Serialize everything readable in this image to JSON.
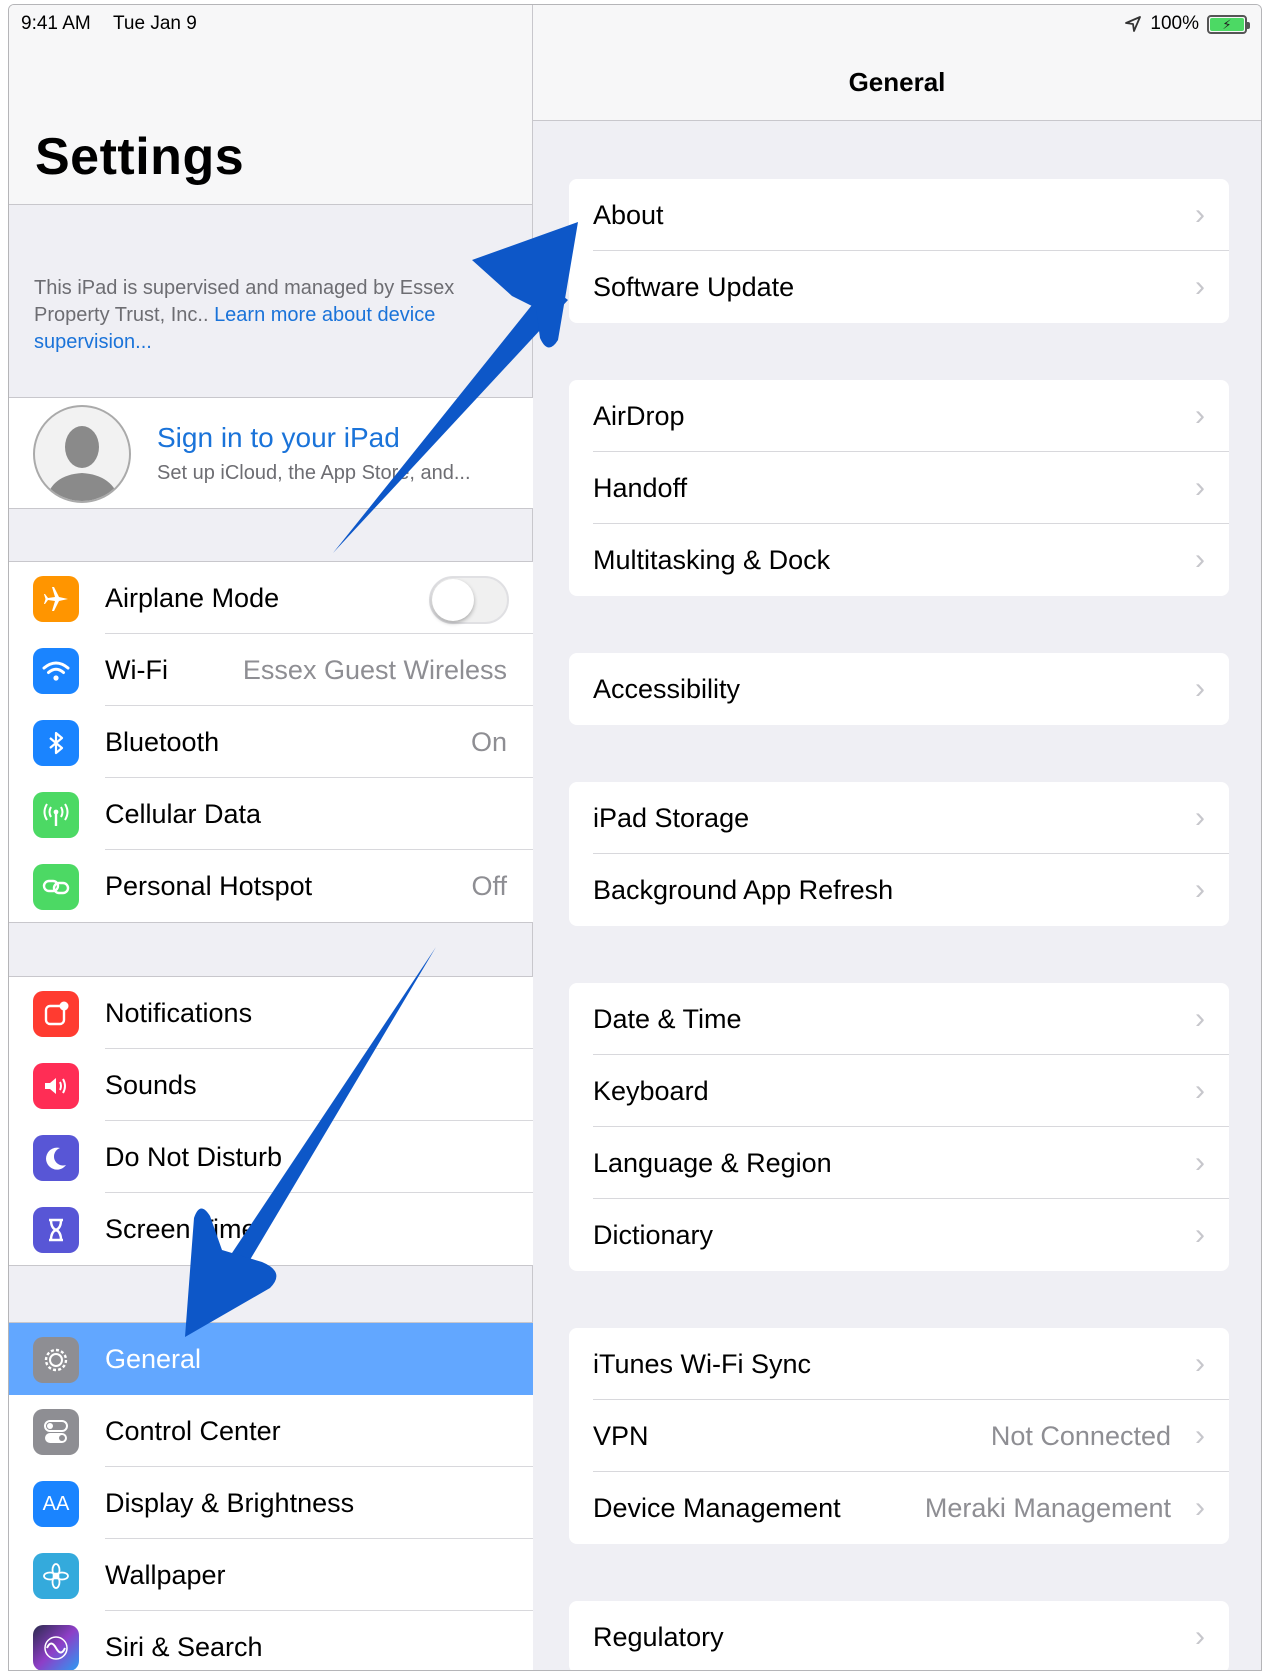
{
  "status_bar": {
    "time": "9:41 AM",
    "date": "Tue Jan 9",
    "battery": "100%"
  },
  "master": {
    "title": "Settings",
    "supervision_text": "This iPad is supervised and managed by Essex Property Trust, Inc.. ",
    "supervision_link": "Learn more about device supervision...",
    "profile": {
      "name": "Sign in to your iPad",
      "subtitle": "Set up iCloud, the App Store, and..."
    },
    "connectivity": [
      {
        "label": "Airplane Mode",
        "value": "",
        "icon": "airplane-icon",
        "color": "#ff9500"
      },
      {
        "label": "Wi-Fi",
        "value": "Essex Guest Wireless",
        "icon": "wifi-icon",
        "color": "#1a84ff"
      },
      {
        "label": "Bluetooth",
        "value": "On",
        "icon": "bluetooth-icon",
        "color": "#1a84ff"
      },
      {
        "label": "Cellular Data",
        "value": "",
        "icon": "antenna-icon",
        "color": "#4cd964"
      },
      {
        "label": "Personal Hotspot",
        "value": "Off",
        "icon": "hotspot-icon",
        "color": "#4cd964"
      }
    ],
    "notifications": [
      {
        "label": "Notifications",
        "icon": "notifications-icon",
        "color": "#ff3b30"
      },
      {
        "label": "Sounds",
        "icon": "speaker-icon",
        "color": "#ff2d55"
      },
      {
        "label": "Do Not Disturb",
        "icon": "moon-icon",
        "color": "#5856d6"
      },
      {
        "label": "Screen Time",
        "icon": "hourglass-icon",
        "color": "#5856d6"
      }
    ],
    "general": [
      {
        "label": "General",
        "icon": "gear-icon",
        "color": "#8e8e93"
      },
      {
        "label": "Control Center",
        "icon": "switches-icon",
        "color": "#8e8e93"
      },
      {
        "label": "Display & Brightness",
        "icon": "text-size-icon",
        "color": "#1a84ff"
      },
      {
        "label": "Wallpaper",
        "icon": "flower-icon",
        "color": "#34aadc"
      },
      {
        "label": "Siri & Search",
        "icon": "siri-icon",
        "color": "#222222"
      }
    ]
  },
  "detail": {
    "title": "General",
    "group1": [
      {
        "label": "About"
      },
      {
        "label": "Software Update"
      }
    ],
    "group2": [
      {
        "label": "AirDrop"
      },
      {
        "label": "Handoff"
      },
      {
        "label": "Multitasking & Dock"
      }
    ],
    "group3": [
      {
        "label": "Accessibility"
      }
    ],
    "group4": [
      {
        "label": "iPad Storage"
      },
      {
        "label": "Background App Refresh"
      }
    ],
    "group5": [
      {
        "label": "Date & Time"
      },
      {
        "label": "Keyboard"
      },
      {
        "label": "Language & Region"
      },
      {
        "label": "Dictionary"
      }
    ],
    "group6": [
      {
        "label": "iTunes Wi-Fi Sync",
        "value": ""
      },
      {
        "label": "VPN",
        "value": "Not Connected"
      },
      {
        "label": "Device Management",
        "value": "Meraki Management"
      }
    ],
    "group7": [
      {
        "label": "Regulatory"
      }
    ]
  },
  "colors": {
    "accent": "#1a73d9",
    "selected_row": "#62a7ff",
    "annotation_arrow": "#0d57c8"
  }
}
